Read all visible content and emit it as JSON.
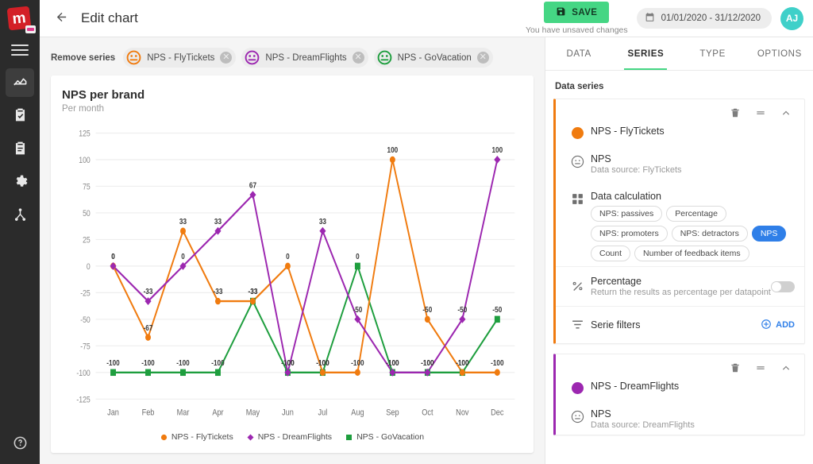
{
  "brand": {
    "logo_letter": "m"
  },
  "rail": {
    "menu_icon": "hamburger-icon",
    "items": [
      {
        "icon": "line-chart-icon",
        "name": "charts",
        "active": true
      },
      {
        "icon": "clipboard-check-icon",
        "name": "tasks",
        "active": false
      },
      {
        "icon": "clipboard-icon",
        "name": "forms",
        "active": false
      },
      {
        "icon": "gear-icon",
        "name": "settings",
        "active": false
      },
      {
        "icon": "share-nodes-icon",
        "name": "integrations",
        "active": false
      }
    ],
    "help_icon": "question-circle-icon"
  },
  "topbar": {
    "back_icon": "arrow-left-icon",
    "title": "Edit chart",
    "save_label": "SAVE",
    "save_icon": "floppy-disk-icon",
    "unsaved_text": "You have unsaved changes",
    "date_range": "01/01/2020 - 31/12/2020",
    "calendar_icon": "calendar-icon",
    "avatar_initials": "AJ",
    "accent_green": "#45d684",
    "avatar_color": "#3fd0c9"
  },
  "remove_series": {
    "label": "Remove series",
    "chips": [
      {
        "label": "NPS - FlyTickets",
        "color": "#f07b0f",
        "icon": "smiley-face-icon",
        "close_icon": "close-icon"
      },
      {
        "label": "NPS - DreamFlights",
        "color": "#9c27b0",
        "icon": "smiley-face-icon",
        "close_icon": "close-icon"
      },
      {
        "label": "NPS - GoVacation",
        "color": "#1e9e3e",
        "icon": "smiley-face-icon",
        "close_icon": "close-icon"
      }
    ]
  },
  "chart_data": {
    "type": "line",
    "title": "NPS per brand",
    "subtitle": "Per month",
    "xlabel": "",
    "ylabel": "",
    "ylim": [
      -125,
      125
    ],
    "yticks": [
      125,
      100,
      75,
      50,
      25,
      0,
      -25,
      -50,
      -75,
      -100,
      -125
    ],
    "grid": true,
    "legend_position": "bottom",
    "data_labels": true,
    "categories": [
      "Jan",
      "Feb",
      "Mar",
      "Apr",
      "May",
      "Jun",
      "Jul",
      "Aug",
      "Sep",
      "Oct",
      "Nov",
      "Dec"
    ],
    "series": [
      {
        "name": "NPS - FlyTickets",
        "color": "#f07b0f",
        "marker": "circle",
        "values": [
          0,
          -67,
          33,
          -33,
          -33,
          0,
          -100,
          -100,
          100,
          -50,
          -100,
          -100
        ]
      },
      {
        "name": "NPS - DreamFlights",
        "color": "#9c27b0",
        "marker": "diamond",
        "values": [
          0,
          -33,
          0,
          33,
          67,
          -100,
          33,
          -50,
          -100,
          -100,
          -50,
          100
        ]
      },
      {
        "name": "NPS - GoVacation",
        "color": "#1e9e3e",
        "marker": "square",
        "values": [
          -100,
          -100,
          -100,
          -100,
          -33,
          -100,
          -100,
          0,
          -100,
          -100,
          -100,
          -50
        ]
      }
    ]
  },
  "panel": {
    "tabs": [
      {
        "label": "DATA",
        "active": false
      },
      {
        "label": "SERIES",
        "active": true
      },
      {
        "label": "TYPE",
        "active": false
      },
      {
        "label": "OPTIONS",
        "active": false
      }
    ],
    "heading": "Data series",
    "tool_icons": {
      "delete": "trash-icon",
      "drag": "drag-handle-icon",
      "collapse": "chevron-up-icon"
    },
    "series": [
      {
        "name": "NPS - FlyTickets",
        "color": "#f07b0f",
        "metric_title": "NPS",
        "metric_source": "Data source: FlyTickets",
        "metric_icon": "smiley-neutral-icon",
        "calc_title": "Data calculation",
        "calc_icon": "grid-icon",
        "calc_options": [
          {
            "label": "NPS: passives",
            "selected": false
          },
          {
            "label": "Percentage",
            "selected": false
          },
          {
            "label": "NPS: promoters",
            "selected": false
          },
          {
            "label": "NPS: detractors",
            "selected": false
          },
          {
            "label": "NPS",
            "selected": true
          },
          {
            "label": "Count",
            "selected": false
          },
          {
            "label": "Number of feedback items",
            "selected": false
          }
        ],
        "percentage_title": "Percentage",
        "percentage_sub": "Return the results as percentage per datapoint",
        "percentage_icon": "percent-icon",
        "percentage_on": false,
        "filters_title": "Serie filters",
        "filters_icon": "filter-icon",
        "filters_add_label": "ADD",
        "filters_add_icon": "plus-circle-icon"
      },
      {
        "name": "NPS - DreamFlights",
        "color": "#9c27b0",
        "metric_title": "NPS",
        "metric_source": "Data source: DreamFlights",
        "metric_icon": "smiley-neutral-icon"
      }
    ]
  }
}
